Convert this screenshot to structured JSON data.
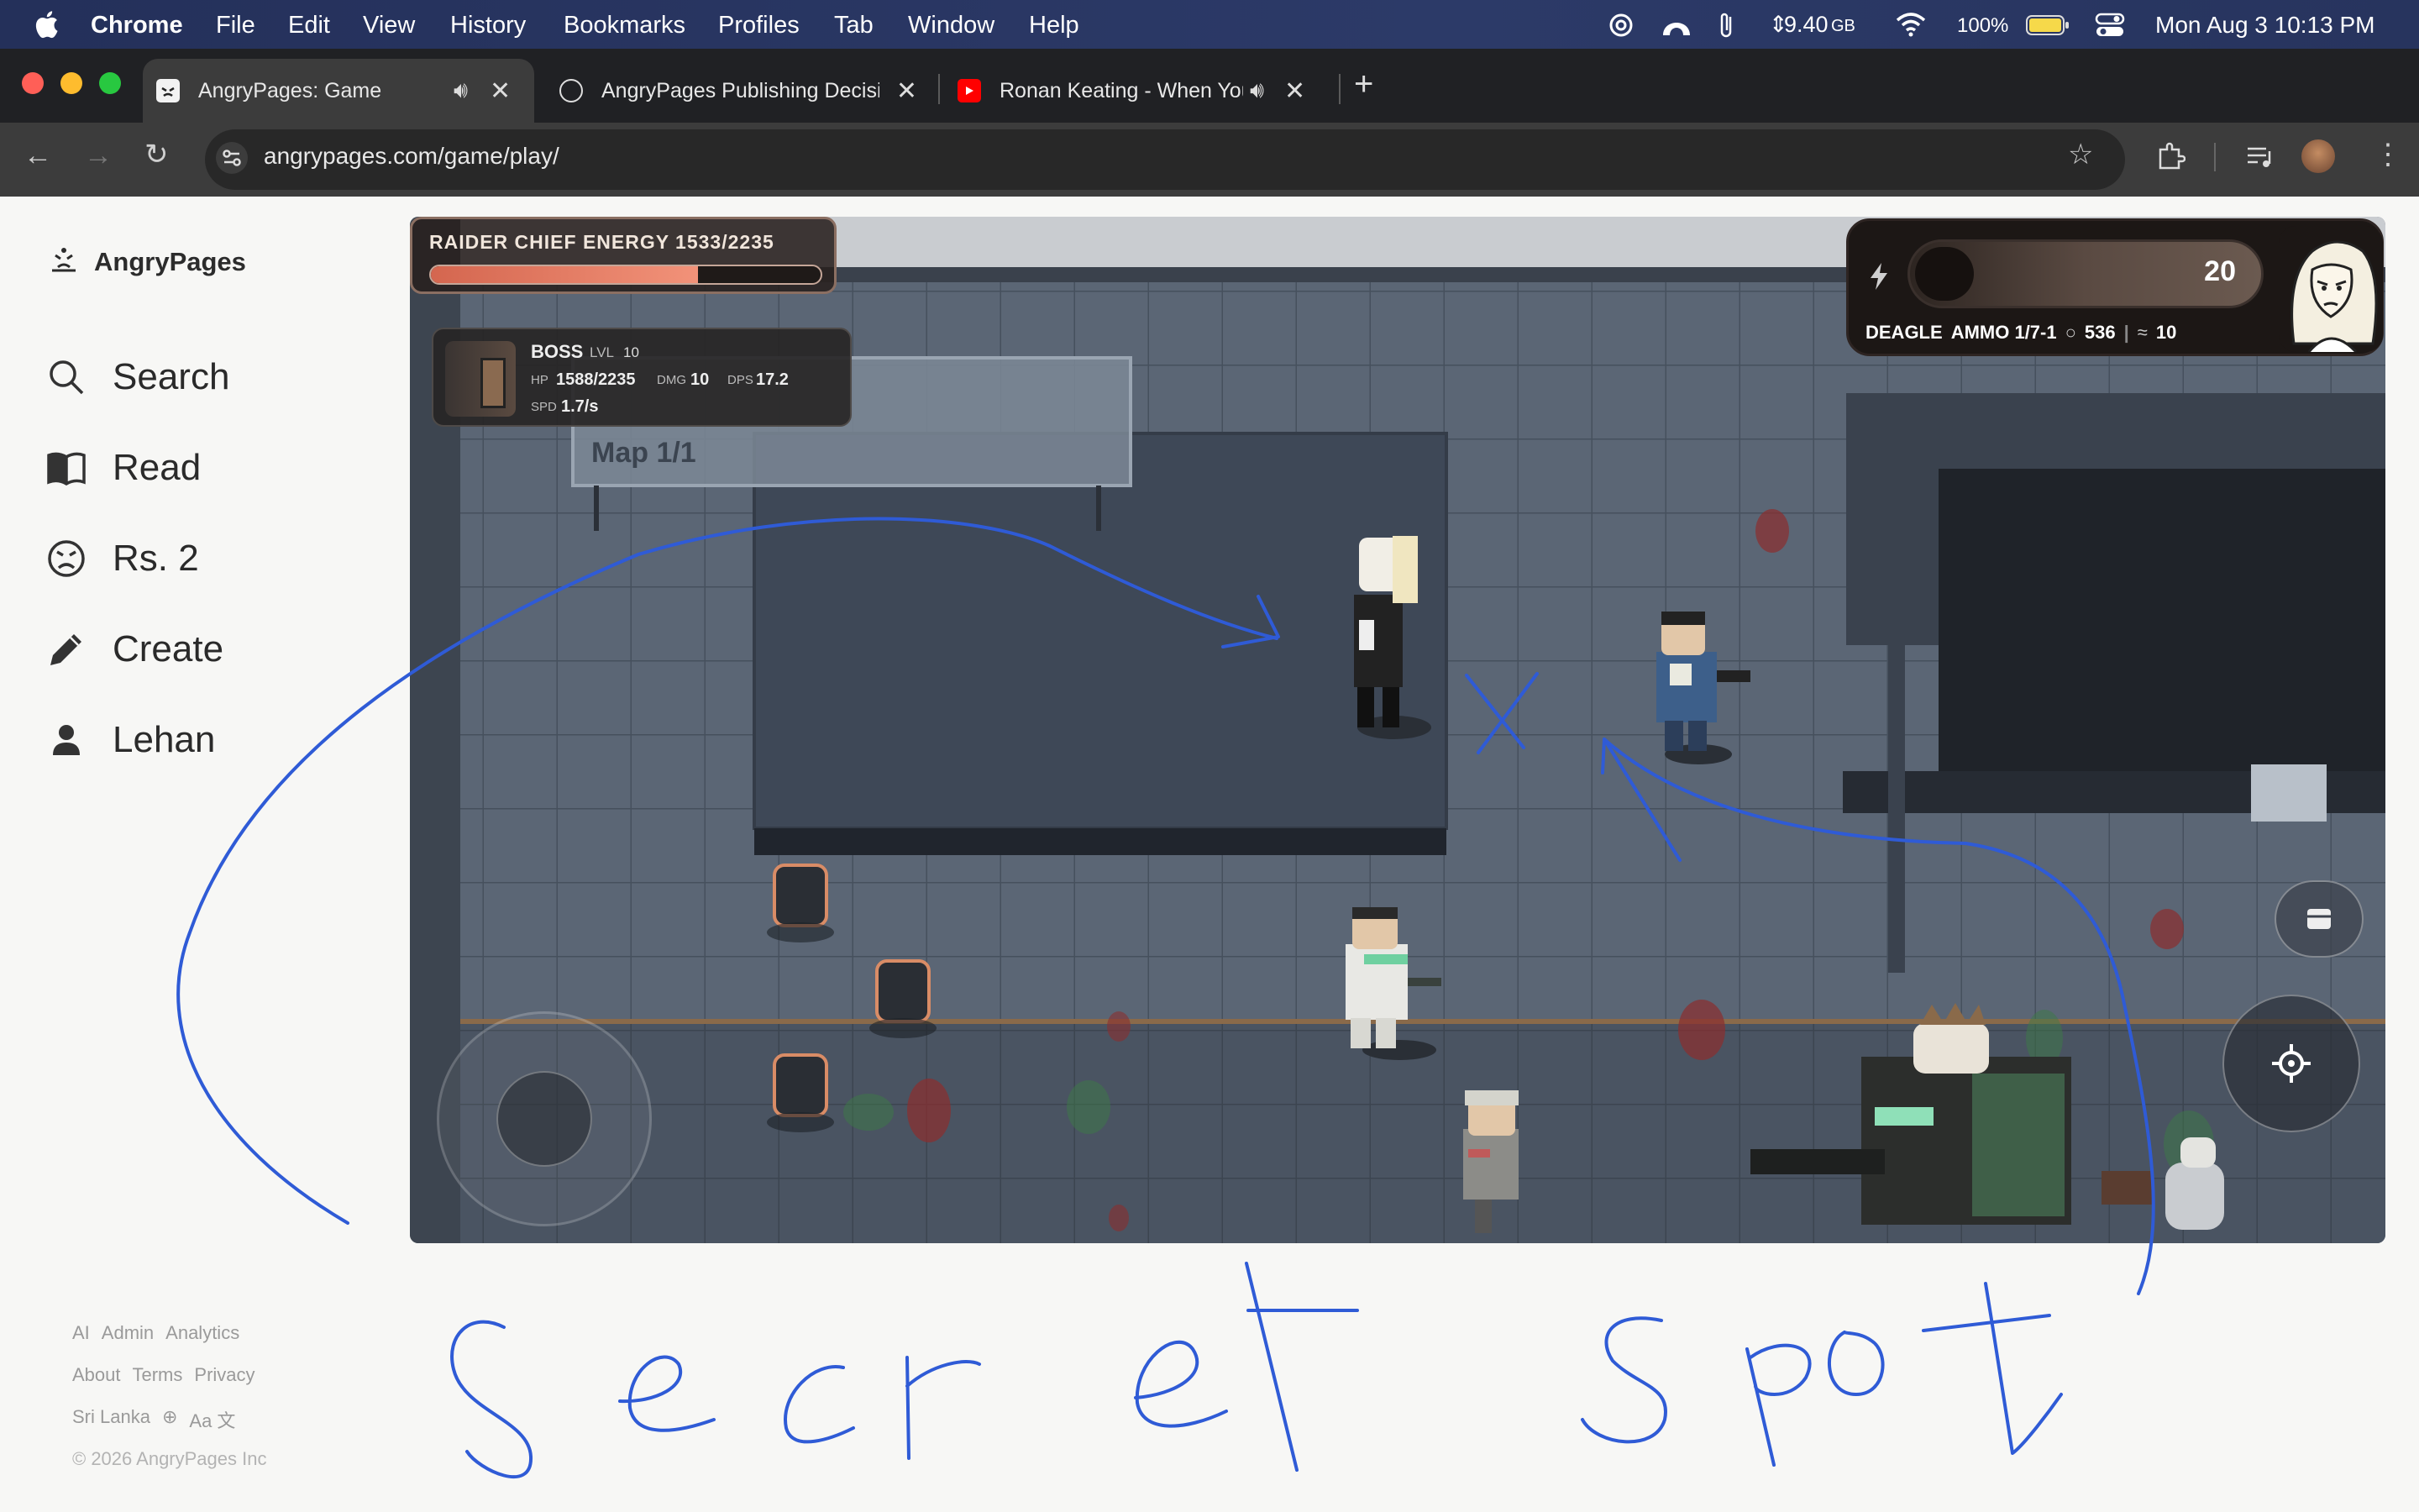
{
  "menubar": {
    "app": "Chrome",
    "items": [
      "File",
      "Edit",
      "View",
      "History",
      "Bookmarks",
      "Profiles",
      "Tab",
      "Window",
      "Help"
    ],
    "memory": "9.40",
    "memory_unit": "GB",
    "battery": "100%",
    "datetime": "Mon Aug 3  10:13 PM"
  },
  "tabs": [
    {
      "title": "AngryPages: Game",
      "favicon": "angrypages-icon",
      "audio": true,
      "active": true
    },
    {
      "title": "AngryPages Publishing Decisi",
      "favicon": "openai-icon",
      "audio": false,
      "active": false
    },
    {
      "title": "Ronan Keating - When You",
      "favicon": "youtube-icon",
      "audio": true,
      "active": false
    }
  ],
  "toolbar": {
    "url": "angrypages.com/game/play/"
  },
  "sidebar": {
    "brand": "AngryPages",
    "items": [
      {
        "label": "Search",
        "icon": "search-icon"
      },
      {
        "label": "Read",
        "icon": "book-icon"
      },
      {
        "label": "Rs. 2",
        "icon": "angry-face-icon"
      },
      {
        "label": "Create",
        "icon": "pencil-icon"
      },
      {
        "label": "Lehan",
        "icon": "user-icon"
      }
    ],
    "footer": {
      "row1": [
        "AI",
        "Admin",
        "Analytics"
      ],
      "row2": [
        "About",
        "Terms",
        "Privacy"
      ],
      "region": "Sri Lanka",
      "lang": "Aa 文",
      "copyright": "© 2026 AngryPages Inc"
    }
  },
  "game": {
    "raider": {
      "label": "RAIDER CHIEF ENERGY 1533/2235",
      "current": 1533,
      "max": 2235
    },
    "boss": {
      "name": "BOSS",
      "lvl_label": "LVL",
      "lvl": "10",
      "hp_label": "HP",
      "hp": "1588/2235",
      "dmg_label": "DMG",
      "dmg": "10",
      "dps_label": "DPS",
      "dps": "17.2",
      "spd_label": "SPD",
      "spd": "1.7/s"
    },
    "map_sign": "Map 1/1",
    "weapon": {
      "count": "20",
      "name": "DEAGLE",
      "ammo": "AMMO 1/7-1",
      "coins": "536",
      "ammo_reserve": "10",
      "coin_icon": "○",
      "reserve_icon": "≈"
    }
  },
  "annotation": {
    "text": "Secret spot",
    "color": "#2f5bd6"
  }
}
